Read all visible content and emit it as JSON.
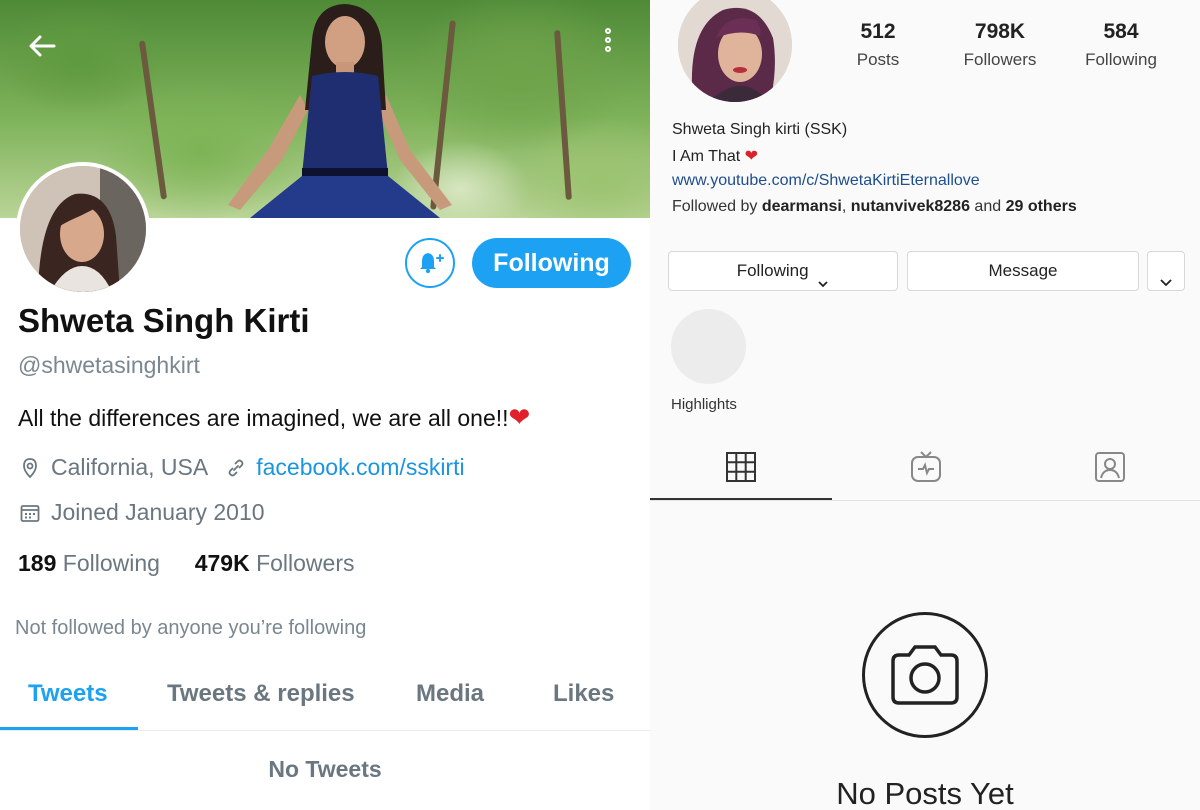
{
  "twitter": {
    "display_name": "Shweta Singh Kirti",
    "handle": "@shwetasinghkirt",
    "bio_text": "All the differences are imagined, we are all one!!",
    "bio_emoji": "❤",
    "location": "California, USA",
    "website": "facebook.com/sskirti",
    "joined": "Joined January 2010",
    "following_count": "189",
    "following_label": "Following",
    "followers_count": "479K",
    "followers_label": "Followers",
    "follow_button_label": "Following",
    "not_followed_text": "Not followed by anyone you’re following",
    "tabs": [
      {
        "label": "Tweets"
      },
      {
        "label": "Tweets & replies"
      },
      {
        "label": "Media"
      },
      {
        "label": "Likes"
      }
    ],
    "empty_state": "No Tweets",
    "accent_color": "#1da1f2",
    "icons": [
      "back-arrow-icon",
      "more-options-icon",
      "notification-bell-icon",
      "location-icon",
      "link-icon",
      "calendar-icon"
    ]
  },
  "instagram": {
    "stats": [
      {
        "value": "512",
        "label": "Posts"
      },
      {
        "value": "798K",
        "label": "Followers"
      },
      {
        "value": "584",
        "label": "Following"
      }
    ],
    "name": "Shweta Singh kirti (SSK)",
    "bio_text": "I Am That",
    "bio_emoji": "❤",
    "link": "www.youtube.com/c/ShwetaKirtiEternallove",
    "followed_by_prefix": "Followed by",
    "followed_by_user1": "dearmansi",
    "followed_by_sep": ",",
    "followed_by_user2": "nutanvivek8286",
    "followed_by_and": "and",
    "followed_by_others": "29 others",
    "following_button": "Following",
    "message_button": "Message",
    "highlights_label": "Highlights",
    "empty_state": "No Posts Yet",
    "icons": [
      "chevron-down-icon",
      "grid-icon",
      "igtv-icon",
      "tagged-icon",
      "camera-icon"
    ]
  }
}
